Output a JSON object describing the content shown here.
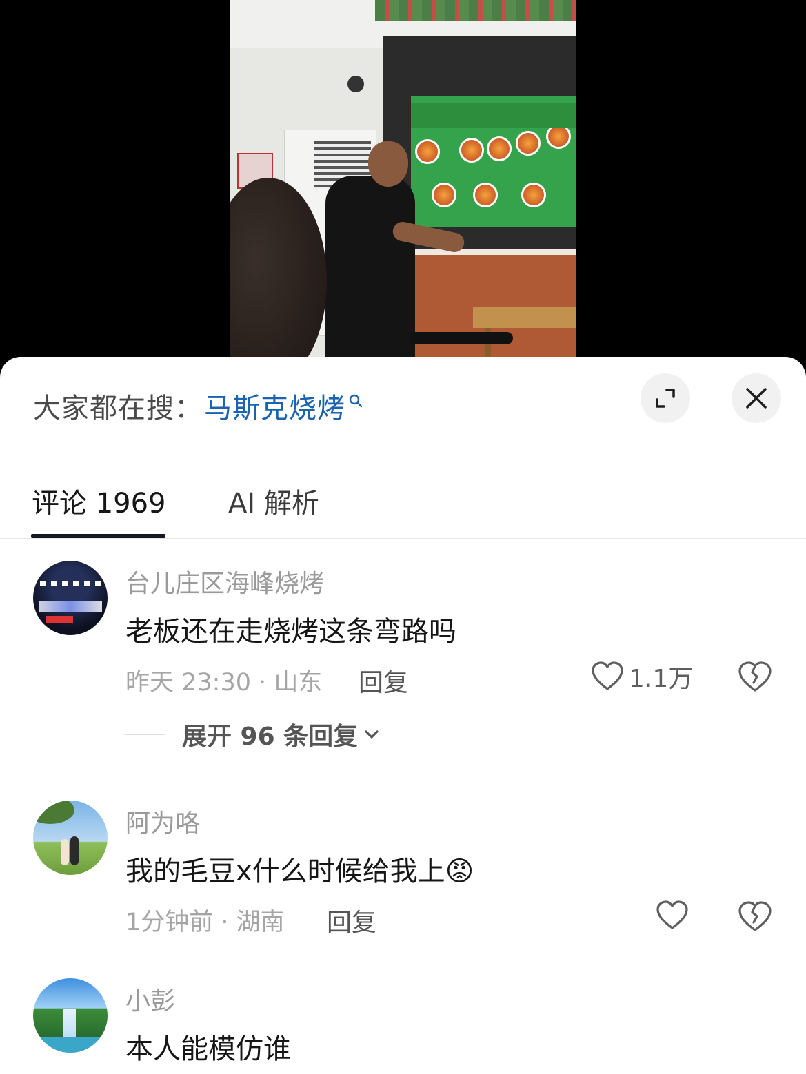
{
  "search_hint": {
    "prefix": "大家都在搜：",
    "query": "马斯克烧烤"
  },
  "tabs": [
    {
      "label": "评论 1969",
      "active": true
    },
    {
      "label": "AI 解析",
      "active": false
    }
  ],
  "comments": [
    {
      "user": "台儿庄区海峰烧烤",
      "text": "老板还在走烧烤这条弯路吗",
      "meta": "昨天 23:30 · 山东",
      "reply_label": "回复",
      "likes": "1.1万",
      "expand_label": "展开 96 条回复"
    },
    {
      "user": "阿为咯",
      "text": "我的毛豆x什么时候给我上😡",
      "meta": "1分钟前 · 湖南",
      "reply_label": "回复",
      "likes": ""
    },
    {
      "user": "小彭",
      "text": "本人能模仿谁"
    }
  ],
  "icons": {
    "search": "search-icon",
    "expand": "expand-icon",
    "close": "close-icon",
    "like": "heart-icon",
    "dislike": "broken-heart-icon",
    "chevron": "chevron-down-icon"
  },
  "colors": {
    "link": "#1a63b0",
    "tab_underline": "#161823",
    "muted_text": "#9a9a9a"
  }
}
